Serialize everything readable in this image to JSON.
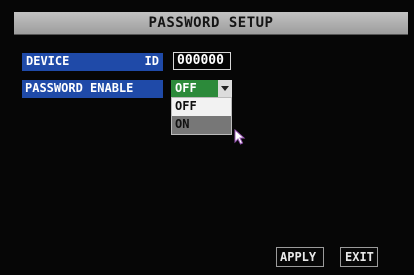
{
  "header": {
    "title": "PASSWORD SETUP"
  },
  "rows": {
    "device_id": {
      "label_left": "DEVICE",
      "label_right": "ID",
      "value": "000000"
    },
    "password_enable": {
      "label": "PASSWORD ENABLE",
      "value": "OFF"
    }
  },
  "dropdown": {
    "options": [
      "OFF",
      "ON"
    ],
    "highlighted": "OFF"
  },
  "buttons": {
    "apply": "APPLY",
    "exit": "EXIT"
  },
  "colors": {
    "label_bg": "#1f4aa8",
    "select_bg": "#2c8a3a",
    "title_bg": "#b0b0b0",
    "background": "#060606"
  },
  "icons": {
    "cursor": "mouse-pointer-icon",
    "select_arrow": "chevron-down-icon"
  }
}
